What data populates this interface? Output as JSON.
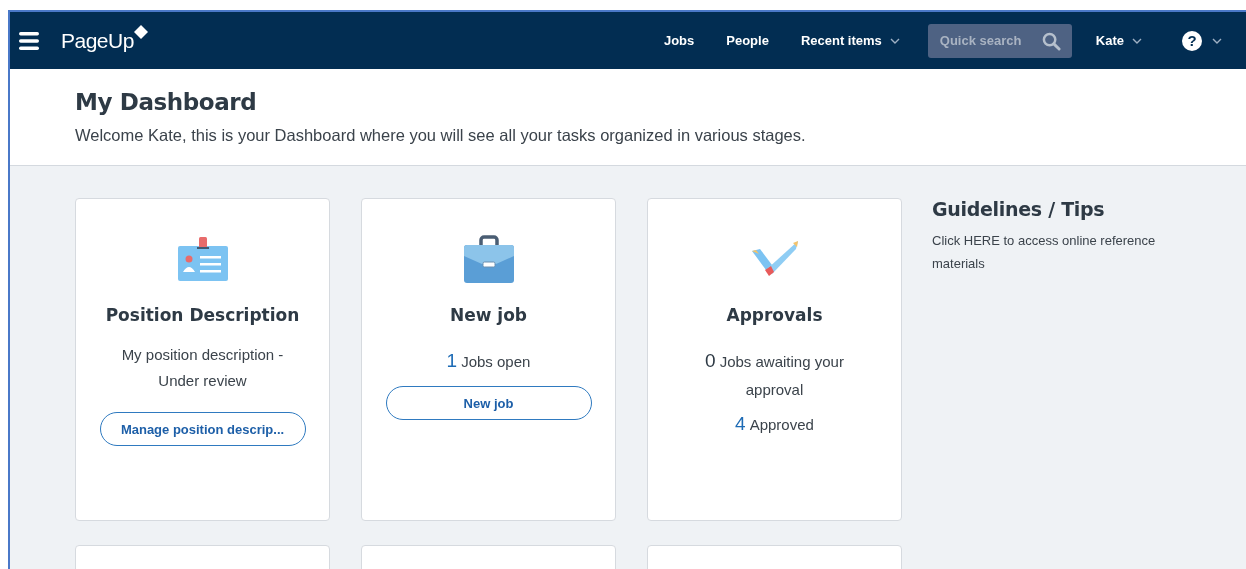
{
  "navbar": {
    "logo": "PageUp",
    "links": [
      {
        "label": "Jobs",
        "dropdown": false
      },
      {
        "label": "People",
        "dropdown": false
      },
      {
        "label": "Recent items",
        "dropdown": true
      }
    ],
    "search": {
      "placeholder": "Quick search"
    },
    "user": {
      "label": "Kate"
    },
    "help": {
      "label": "?"
    }
  },
  "header": {
    "title": "My Dashboard",
    "subtitle": "Welcome Kate, this is your Dashboard where you will see all your tasks organized in various stages."
  },
  "cards": [
    {
      "kind": "position",
      "title": "Position Description",
      "description": "My position description - Under review",
      "button": "Manage position descrip..."
    },
    {
      "kind": "job",
      "title": "New job",
      "stats": [
        {
          "count": "1",
          "label": "Jobs open",
          "link": true
        }
      ],
      "button": "New job"
    },
    {
      "kind": "approvals",
      "title": "Approvals",
      "stats": [
        {
          "count": "0",
          "label": "Jobs awaiting your approval",
          "link": false
        },
        {
          "count": "4",
          "label": "Approved",
          "link": true
        }
      ]
    },
    {
      "kind": "blank"
    },
    {
      "kind": "blank"
    },
    {
      "kind": "blank"
    }
  ],
  "guidelines": {
    "title": "Guidelines / Tips",
    "text": "Click HERE to access online reference materials"
  }
}
